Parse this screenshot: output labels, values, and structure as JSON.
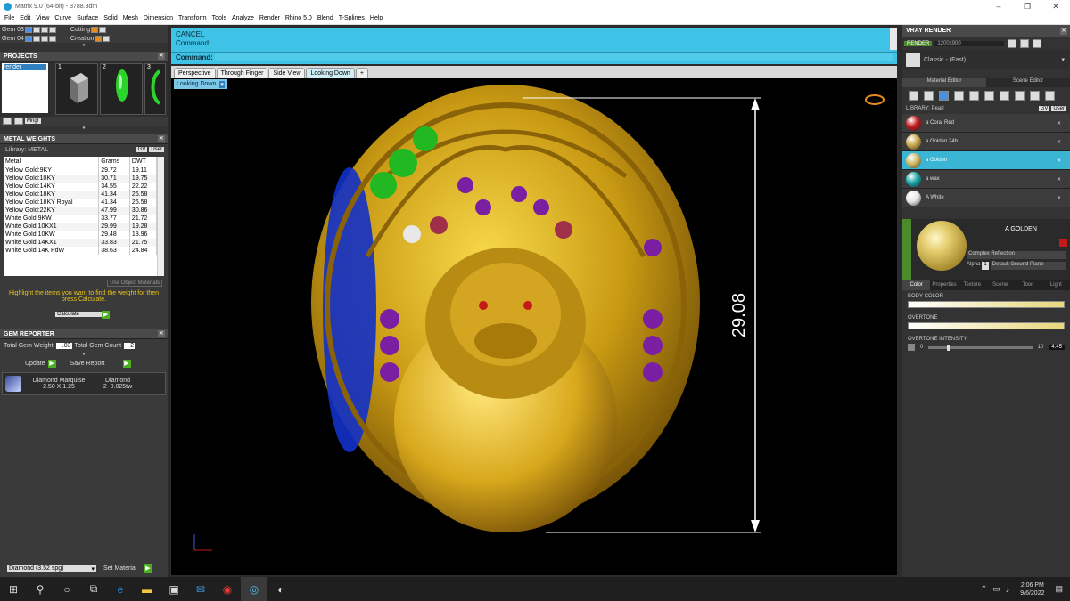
{
  "window": {
    "title": "Matrix 9.0 (64-bit) - 3788.3dm"
  },
  "menu": [
    "File",
    "Edit",
    "View",
    "Curve",
    "Surface",
    "Solid",
    "Mesh",
    "Dimension",
    "Transform",
    "Tools",
    "Analyze",
    "Render",
    "Rhino 5.0",
    "Blend",
    "T-Splines",
    "Help"
  ],
  "gems_rows": [
    {
      "label": "Gem 03",
      "right": "Cutting"
    },
    {
      "label": "Gem 04",
      "right": "Creation"
    }
  ],
  "projects": {
    "title": "PROJECTS",
    "item": "render",
    "thumbs": [
      "1",
      "2",
      "3"
    ],
    "mngr": "Mngr"
  },
  "metal_weights": {
    "title": "METAL WEIGHTS",
    "library": "Library: METAL",
    "gv": "GV",
    "user": "User",
    "headers": [
      "Metal",
      "Grams",
      "DWT"
    ],
    "rows": [
      [
        "Yellow Gold:9KY",
        "29.72",
        "19.11"
      ],
      [
        "Yellow Gold:10KY",
        "30.71",
        "19.75"
      ],
      [
        "Yellow Gold:14KY",
        "34.55",
        "22.22"
      ],
      [
        "Yellow Gold:18KY",
        "41.34",
        "26.58"
      ],
      [
        "Yellow Gold:18KY Royal",
        "41.34",
        "26.58"
      ],
      [
        "Yellow Gold:22KY",
        "47.99",
        "30.86"
      ],
      [
        "White Gold:9KW",
        "33.77",
        "21.72"
      ],
      [
        "White Gold:10KX1",
        "29.99",
        "19.28"
      ],
      [
        "White Gold:10KW",
        "29.48",
        "18.96"
      ],
      [
        "White Gold:14KX1",
        "33.83",
        "21.75"
      ],
      [
        "White Gold:14K PdW",
        "38.63",
        "24.84"
      ]
    ],
    "use_object_materials": "Use Object Materials",
    "hint": "Highlight the items you want to find the weight for then press Calculate.",
    "calculate": "Calculate"
  },
  "gem_reporter": {
    "title": "GEM REPORTER",
    "total_weight_label": "Total Gem Weight",
    "total_weight": ".03",
    "total_count_label": "Total Gem Count",
    "total_count": "2",
    "update": "Update",
    "save_report": "Save Report",
    "gem_cut": "Diamond Marquise",
    "gem_size": "2.50 X 1.25",
    "gem_type": "Diamond",
    "gem_qty": "2",
    "gem_tw": "0.025tw"
  },
  "bottom_left": {
    "material": "Diamond    (3.52 spg)",
    "set_material": "Set Material"
  },
  "command": {
    "line1": "CANCEL",
    "line2": "Command:",
    "prompt": "Command:"
  },
  "viewport": {
    "tabs": [
      "Perspective",
      "Through Finger",
      "Side View",
      "Looking Down",
      "+"
    ],
    "active_tab": 3,
    "label": "Looking Down",
    "dimension": "29.08"
  },
  "vray": {
    "title": "VRAY RENDER",
    "render": "RENDER",
    "resolution": "1200x900",
    "preset": "Classic - (Fast)",
    "tab_material": "Material Editor",
    "tab_scene": "Scene Editor",
    "library": "LIBRARY: Pearl",
    "gv": "GV",
    "user": "User",
    "materials": [
      {
        "name": "a Coral Red",
        "color": "#c41a1a"
      },
      {
        "name": "a Golden 24b",
        "color": "#c9a84a"
      },
      {
        "name": "a Golden",
        "color": "#cfb865"
      },
      {
        "name": "a wax",
        "color": "#1aa7a7"
      },
      {
        "name": "A White",
        "color": "#e8e8e8"
      }
    ],
    "selected_material": 2,
    "preview_name": "A GOLDEN",
    "reflection": "Complex Reflection",
    "alpha": "Alpha",
    "alpha_val": "1",
    "ground": "Default Ground Plane",
    "prop_tabs": [
      "Color",
      "Properties",
      "Texture",
      "Scene",
      "Toon",
      "Light"
    ],
    "body_color": "BODY COLOR",
    "overtone": "OVERTONE",
    "overtone_intensity": "OVERTONE INTENSITY",
    "oi_min": "0",
    "oi_max": "10",
    "oi_value": "4.45"
  },
  "taskbar": {
    "time": "2:06 PM",
    "date": "9/6/2022"
  }
}
